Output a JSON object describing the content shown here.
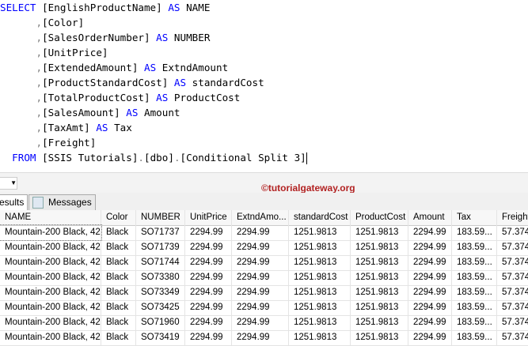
{
  "query": {
    "l1": {
      "kw": "SELECT",
      "text": " [EnglishProductName] ",
      "as": "AS",
      "alias": " NAME"
    },
    "l2": "[Color]",
    "l3": {
      "text": "[SalesOrderNumber] ",
      "as": "AS",
      "alias": " NUMBER"
    },
    "l4": "[UnitPrice]",
    "l5": {
      "text": "[ExtendedAmount] ",
      "as": "AS",
      "alias": " ExtndAmount"
    },
    "l6": {
      "text": "[ProductStandardCost] ",
      "as": "AS",
      "alias": " standardCost"
    },
    "l7": {
      "text": "[TotalProductCost] ",
      "as": "AS",
      "alias": " ProductCost"
    },
    "l8": {
      "text": "[SalesAmount] ",
      "as": "AS",
      "alias": " Amount"
    },
    "l9": {
      "text": "[TaxAmt] ",
      "as": "AS",
      "alias": " Tax"
    },
    "l10": "[Freight]",
    "l11": {
      "kw": "FROM",
      "a": " [SSIS Tutorials]",
      "b": "[dbo]",
      "c": "[Conditional Split 3]"
    },
    "comma": ",",
    "dot": "."
  },
  "watermark": "©tutorialgateway.org",
  "tabs": {
    "results": "esults",
    "messages": "Messages"
  },
  "columns": [
    "NAME",
    "Color",
    "NUMBER",
    "UnitPrice",
    "ExtndAmo...",
    "standardCost",
    "ProductCost",
    "Amount",
    "Tax",
    "Freight"
  ],
  "rows": [
    [
      "Mountain-200 Black, 42",
      "Black",
      "SO71737",
      "2294.99",
      "2294.99",
      "1251.9813",
      "1251.9813",
      "2294.99",
      "183.59...",
      "57.374"
    ],
    [
      "Mountain-200 Black, 42",
      "Black",
      "SO71739",
      "2294.99",
      "2294.99",
      "1251.9813",
      "1251.9813",
      "2294.99",
      "183.59...",
      "57.374"
    ],
    [
      "Mountain-200 Black, 42",
      "Black",
      "SO71744",
      "2294.99",
      "2294.99",
      "1251.9813",
      "1251.9813",
      "2294.99",
      "183.59...",
      "57.374"
    ],
    [
      "Mountain-200 Black, 42",
      "Black",
      "SO73380",
      "2294.99",
      "2294.99",
      "1251.9813",
      "1251.9813",
      "2294.99",
      "183.59...",
      "57.374"
    ],
    [
      "Mountain-200 Black, 42",
      "Black",
      "SO73349",
      "2294.99",
      "2294.99",
      "1251.9813",
      "1251.9813",
      "2294.99",
      "183.59...",
      "57.374"
    ],
    [
      "Mountain-200 Black, 42",
      "Black",
      "SO73425",
      "2294.99",
      "2294.99",
      "1251.9813",
      "1251.9813",
      "2294.99",
      "183.59...",
      "57.374"
    ],
    [
      "Mountain-200 Black, 42",
      "Black",
      "SO71960",
      "2294.99",
      "2294.99",
      "1251.9813",
      "1251.9813",
      "2294.99",
      "183.59...",
      "57.374"
    ],
    [
      "Mountain-200 Black, 42",
      "Black",
      "SO73419",
      "2294.99",
      "2294.99",
      "1251.9813",
      "1251.9813",
      "2294.99",
      "183.59...",
      "57.374"
    ]
  ]
}
